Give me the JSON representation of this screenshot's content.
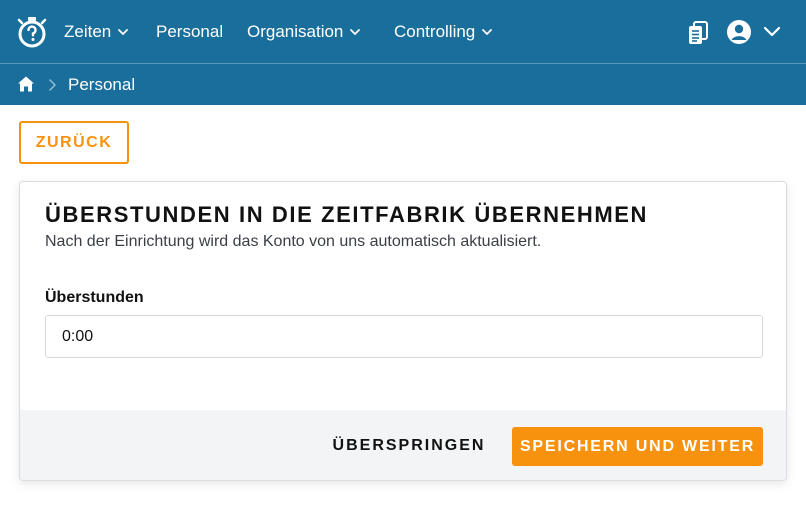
{
  "header": {
    "logo_icon": "stopwatch-logo-icon",
    "nav": [
      {
        "label": "Zeiten",
        "has_dropdown": true
      },
      {
        "label": "Personal",
        "has_dropdown": false
      },
      {
        "label": "Organisation",
        "has_dropdown": true
      },
      {
        "label": "Controlling",
        "has_dropdown": true
      }
    ],
    "actions": {
      "documents_icon": "documents-icon",
      "user_icon": "user-circle-icon",
      "user_menu_icon": "chevron-down-icon"
    },
    "background_color": "#1a6e9b"
  },
  "breadcrumb": {
    "home_icon": "home-icon",
    "separator_icon": "chevron-right-icon",
    "current": "Personal"
  },
  "back_button": {
    "label": "ZURÜCK"
  },
  "card": {
    "title": "ÜBERSTUNDEN IN DIE ZEITFABRIK ÜBERNEHMEN",
    "subtitle": "Nach der Einrichtung wird das Konto von uns automatisch aktualisiert.",
    "field": {
      "label": "Überstunden",
      "value": "0:00"
    },
    "footer": {
      "skip_label": "ÜBERSPRINGEN",
      "save_label": "SPEICHERN UND WEITER"
    }
  },
  "colors": {
    "accent": "#f7920f",
    "header": "#1a6e9b",
    "footer_bg": "#f3f4f6"
  }
}
